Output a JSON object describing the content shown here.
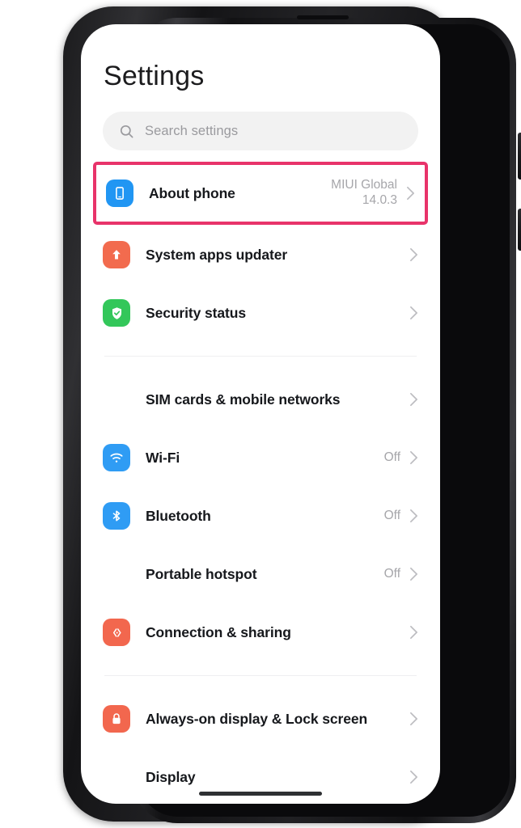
{
  "device": {
    "frame_color": "#1b1b1d",
    "screen_background": "#ffffff",
    "buttons": [
      "power-button",
      "volume-up",
      "left-button"
    ]
  },
  "header": {
    "title": "Settings"
  },
  "search": {
    "icon": "search-icon",
    "placeholder": "Search settings",
    "value": "",
    "background": "#f2f2f2"
  },
  "highlight": {
    "color": "#e8336a",
    "target": "About phone"
  },
  "groups": [
    {
      "id": "group-device",
      "items": [
        {
          "label": "About phone",
          "value": "MIUI Global 14.0.3",
          "icon": "phone-icon",
          "icon_color": "#2196f3",
          "highlighted": true
        },
        {
          "label": "System apps updater",
          "value": "",
          "icon": "arrow-up-icon",
          "icon_color": "#f26b4e",
          "highlighted": false
        },
        {
          "label": "Security status",
          "value": "",
          "icon": "shield-check-icon",
          "icon_color": "#33c75a",
          "highlighted": false
        }
      ]
    },
    {
      "id": "group-connectivity",
      "items": [
        {
          "label": "SIM cards & mobile networks",
          "value": "",
          "icon": "sim-card-icon",
          "icon_color": "#f5c council",
          "highlighted": false
        },
        {
          "label": "Wi-Fi",
          "value": "Off",
          "icon": "wifi-icon",
          "icon_color": "#2f9cf4",
          "highlighted": false
        },
        {
          "label": "Bluetooth",
          "value": "Off",
          "icon": "bluetooth-icon",
          "icon_color": "#2f9cf4",
          "highlighted": false
        },
        {
          "label": "Portable hotspot",
          "value": "Off",
          "icon": "hotspot-icon",
          "icon_color": "#f5c council",
          "highlighted": false
        },
        {
          "label": "Connection & sharing",
          "value": "",
          "icon": "connection-sharing-icon",
          "icon_color": "#f2674e",
          "highlighted": false
        }
      ]
    },
    {
      "id": "group-display",
      "items": [
        {
          "label": "Always-on display & Lock screen",
          "value": "",
          "icon": "lock-icon",
          "icon_color": "#f2674e",
          "highlighted": false
        },
        {
          "label": "Display",
          "value": "",
          "icon": "brightness-icon",
          "icon_color": "#f7c council",
          "highlighted": false
        }
      ]
    }
  ]
}
